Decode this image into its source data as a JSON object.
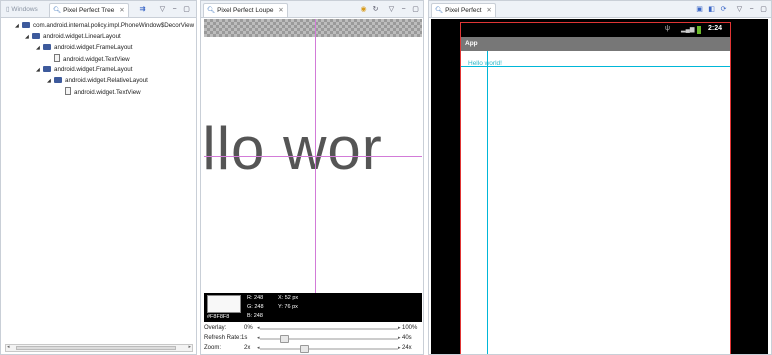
{
  "tree_panel": {
    "tabs": {
      "windows": "Windows",
      "pixel_perfect_tree": "Pixel Perfect Tree"
    },
    "nodes": [
      {
        "label": "com.android.internal.policy.impl.PhoneWindow$DecorView",
        "depth": 0,
        "type": "package"
      },
      {
        "label": "android.widget.LinearLayout",
        "depth": 1,
        "type": "package"
      },
      {
        "label": "android.widget.FrameLayout",
        "depth": 2,
        "type": "package"
      },
      {
        "label": "android.widget.TextView",
        "depth": 3,
        "type": "leaf"
      },
      {
        "label": "android.widget.FrameLayout",
        "depth": 2,
        "type": "package"
      },
      {
        "label": "android.widget.RelativeLayout",
        "depth": 3,
        "type": "package"
      },
      {
        "label": "android.widget.TextView",
        "depth": 4,
        "type": "leaf"
      }
    ]
  },
  "loupe_panel": {
    "tab": "Pixel Perfect Loupe",
    "zoomed_text": "ello wor",
    "pixel": {
      "color_hex": "#f8f8f8",
      "hex_label": "#F8F8F8",
      "r": "R: 248",
      "g": "G: 248",
      "b": "B: 248",
      "x": "X: 52 px",
      "y": "Y: 76 px"
    },
    "controls": {
      "overlay": {
        "label": "Overlay:",
        "value": "0%",
        "max": "100%"
      },
      "refresh": {
        "label": "Refresh Rate:",
        "value": "1s",
        "max": "40s"
      },
      "zoom": {
        "label": "Zoom:",
        "value": "2x",
        "max": "24x"
      }
    }
  },
  "pixel_perfect_panel": {
    "tab": "Pixel Perfect",
    "status_time": "2:24",
    "app_title": "App",
    "hello_text": "Hello world!"
  },
  "colors": {
    "tab_bg": "#eef2f7",
    "border": "#c9cfd7",
    "crosshair": "#d27bd8",
    "guide": "#00b7d8",
    "frame_border": "#e03535"
  }
}
